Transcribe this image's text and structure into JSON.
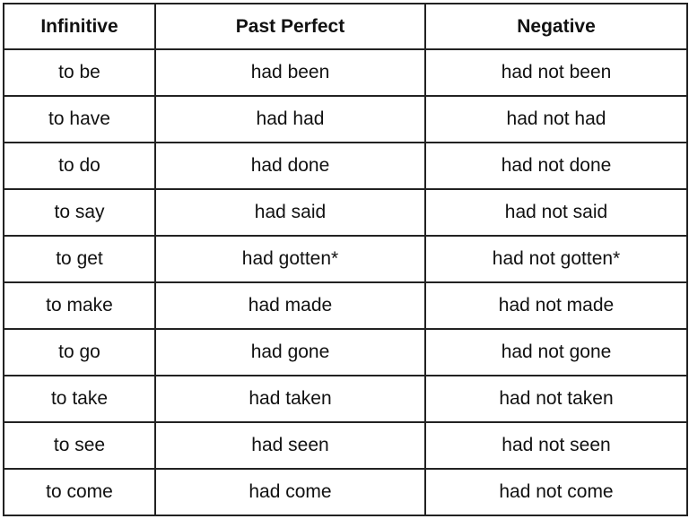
{
  "table": {
    "headers": [
      "Infinitive",
      "Past Perfect",
      "Negative"
    ],
    "rows": [
      [
        "to be",
        "had been",
        "had not been"
      ],
      [
        "to have",
        "had had",
        "had not had"
      ],
      [
        "to do",
        "had done",
        "had not done"
      ],
      [
        "to say",
        "had said",
        "had not said"
      ],
      [
        "to get",
        "had gotten*",
        "had not gotten*"
      ],
      [
        "to make",
        "had made",
        "had not made"
      ],
      [
        "to go",
        "had gone",
        "had not gone"
      ],
      [
        "to take",
        "had taken",
        "had not taken"
      ],
      [
        "to see",
        "had seen",
        "had not seen"
      ],
      [
        "to come",
        "had come",
        "had not come"
      ]
    ]
  }
}
